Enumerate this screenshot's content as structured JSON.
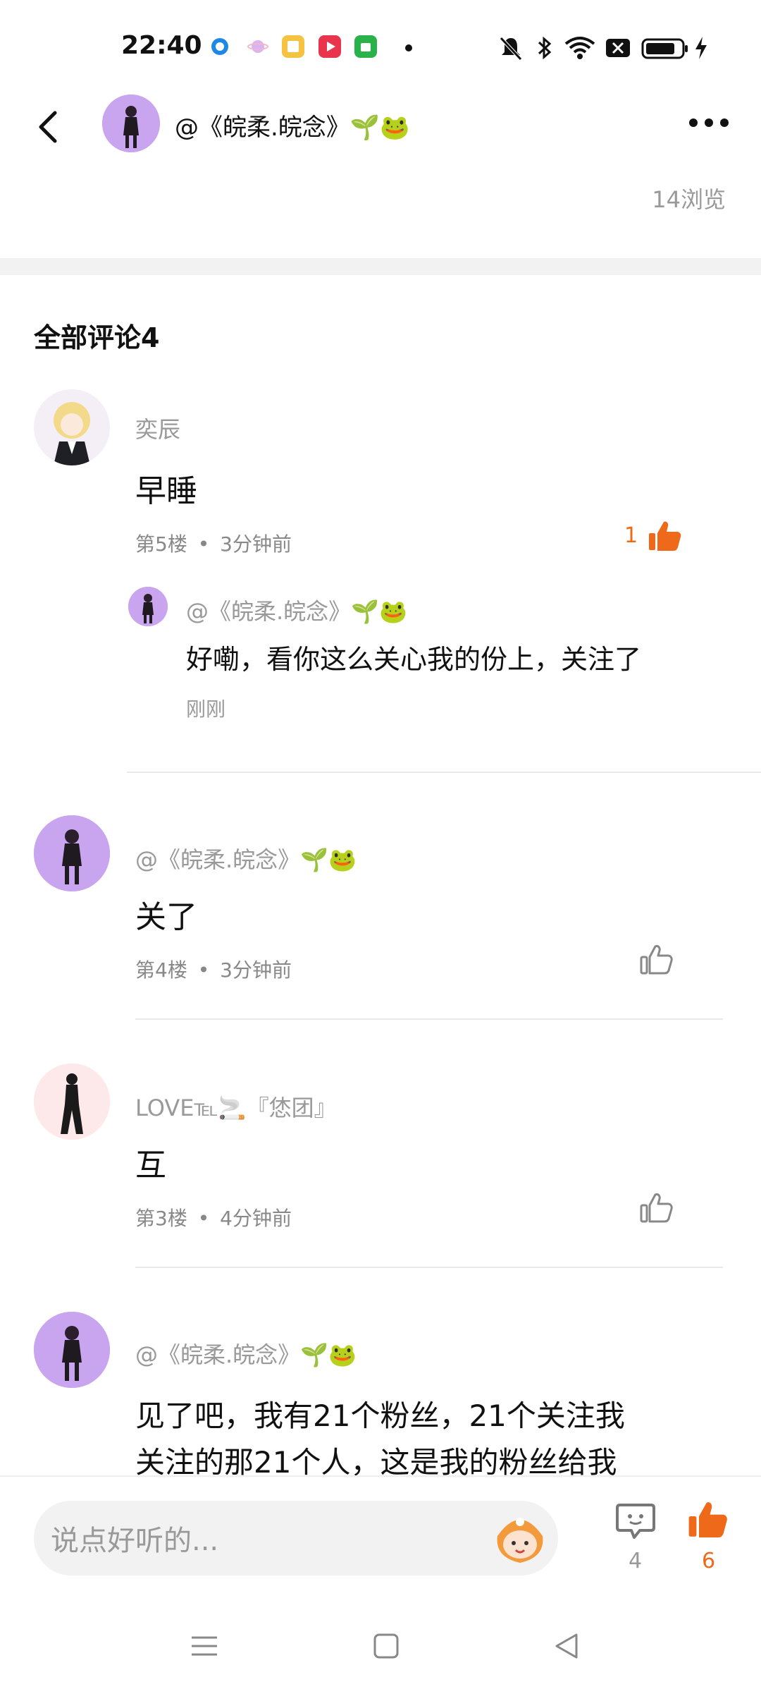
{
  "status_bar": {
    "time": "22:40",
    "left_icons": [
      "browser-app-icon",
      "planet-app-icon",
      "books-app-icon",
      "video-app-icon",
      "store-app-icon",
      "dot-indicator"
    ],
    "right_icons": [
      "mute-bell-icon",
      "bluetooth-icon",
      "wifi-icon",
      "no-sim-icon",
      "battery-icon",
      "charging-icon"
    ]
  },
  "header": {
    "username": "@《皖柔.皖念》🌱🐸",
    "views": "14浏览"
  },
  "comments_section": {
    "title": "全部评论4"
  },
  "comments": [
    {
      "name": "奕辰",
      "content": "早睡",
      "floor": "第5楼",
      "time": "3分钟前",
      "likes": "1",
      "liked": true,
      "reply": {
        "name": "@《皖柔.皖念》🌱🐸",
        "text": "好嘞，看你这么关心我的份上，关注了",
        "time": "刚刚"
      }
    },
    {
      "name": "@《皖柔.皖念》🌱🐸",
      "content": "关了",
      "floor": "第4楼",
      "time": "3分钟前"
    },
    {
      "name": "LOVE℡🚬『恷团』",
      "content": "互",
      "floor": "第3楼",
      "time": "4分钟前"
    },
    {
      "name": "@《皖柔.皖念》🌱🐸",
      "content_line1": "见了吧，我有21个粉丝，21个关注我",
      "content_line2": "关注的那21个人，这是我的粉丝给我"
    }
  ],
  "meta_separator": "•",
  "bottom_bar": {
    "input_placeholder": "说点好听的...",
    "comment_count": "4",
    "like_count": "6"
  },
  "colors": {
    "accent_orange": "#ee6a1a",
    "gray_text": "#999999",
    "divider": "#e9e9e9"
  }
}
